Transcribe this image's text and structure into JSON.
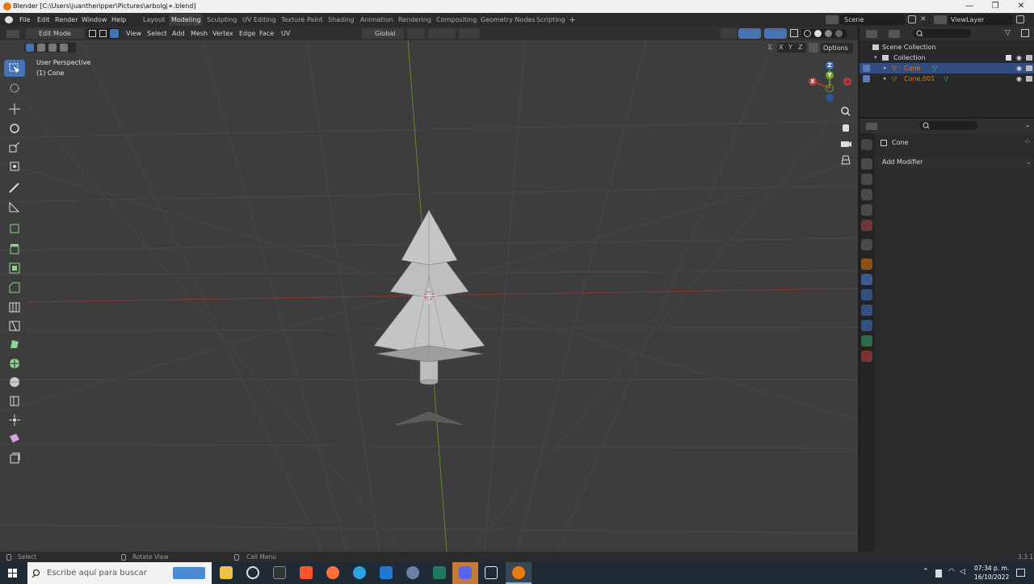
{
  "window": {
    "title": "Blender [C:\\Users\\juantheripper\\Pictures\\arbolgj+.blend]",
    "minimize": "—",
    "maximize": "❐",
    "close": "✕"
  },
  "menu": {
    "items": [
      "File",
      "Edit",
      "Render",
      "Window",
      "Help"
    ]
  },
  "workspaces": {
    "tabs": [
      "Layout",
      "Modeling",
      "Sculpting",
      "UV Editing",
      "Texture Paint",
      "Shading",
      "Animation",
      "Rendering",
      "Compositing",
      "Geometry Nodes",
      "Scripting"
    ],
    "active": "Modeling",
    "add": "+"
  },
  "scene": {
    "name": "Scene",
    "view_layer": "ViewLayer"
  },
  "viewport_header": {
    "mode": "Edit Mode",
    "menus": [
      "View",
      "Select",
      "Add",
      "Mesh",
      "Vertex",
      "Edge",
      "Face",
      "UV"
    ],
    "orientation": "Global",
    "options": "Options",
    "axes": [
      "X",
      "Y",
      "Z"
    ]
  },
  "viewport": {
    "view_name": "User Perspective",
    "object_name": "(1) Cone"
  },
  "gizmo": {
    "z": "Z",
    "y": "Y",
    "x": "X"
  },
  "outliner": {
    "root": "Scene Collection",
    "collection": "Collection",
    "objects": [
      "Cone",
      "Cone.001"
    ]
  },
  "properties": {
    "object": "Cone",
    "add_modifier": "Add Modifier"
  },
  "status": {
    "select": "Select",
    "rotate": "Rotate View",
    "call_menu": "Call Menu",
    "version": "3.3.1"
  },
  "taskbar": {
    "search_placeholder": "Escribe aquí para buscar",
    "time": "07:34 p. m.",
    "date": "16/10/2022"
  },
  "colors": {
    "accent": "#4772b3",
    "selected_row": "#334d80",
    "orange": "#e87d0d",
    "x_axis": "#c23b3b",
    "y_axis": "#6fa21f"
  }
}
